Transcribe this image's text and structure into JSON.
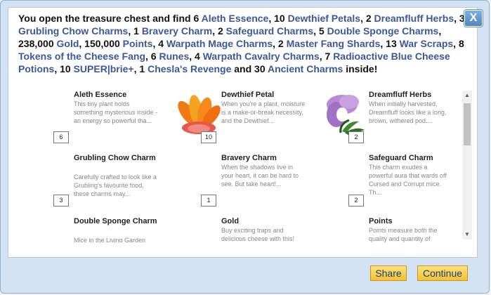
{
  "dialog": {
    "message": {
      "parts": [
        {
          "t": "You open the treasure chest and find 6 ",
          "link": false
        },
        {
          "t": "Aleth Essence",
          "link": true
        },
        {
          "t": ", 10 ",
          "link": false
        },
        {
          "t": "Dewthief Petals",
          "link": true
        },
        {
          "t": ", 2 ",
          "link": false
        },
        {
          "t": "Dreamfluff Herbs",
          "link": true
        },
        {
          "t": ", 3 ",
          "link": false
        },
        {
          "t": "Grubling Chow Charms",
          "link": true
        },
        {
          "t": ", 1 ",
          "link": false
        },
        {
          "t": "Bravery Charm",
          "link": true
        },
        {
          "t": ", 2 ",
          "link": false
        },
        {
          "t": "Safeguard Charms",
          "link": true
        },
        {
          "t": ", 5 ",
          "link": false
        },
        {
          "t": "Double Sponge Charms",
          "link": true
        },
        {
          "t": ", 238,000 ",
          "link": false
        },
        {
          "t": "Gold",
          "link": true
        },
        {
          "t": ", 150,000 ",
          "link": false
        },
        {
          "t": "Points",
          "link": true
        },
        {
          "t": ", 4 ",
          "link": false
        },
        {
          "t": "Warpath Mage Charms",
          "link": true
        },
        {
          "t": ", 2 ",
          "link": false
        },
        {
          "t": "Master Fang Shards",
          "link": true
        },
        {
          "t": ", 13 ",
          "link": false
        },
        {
          "t": "War Scraps",
          "link": true
        },
        {
          "t": ", 8 ",
          "link": false
        },
        {
          "t": "Tokens of the Cheese Fang",
          "link": true
        },
        {
          "t": ", 6 ",
          "link": false
        },
        {
          "t": "Runes",
          "link": true
        },
        {
          "t": ", 4 ",
          "link": false
        },
        {
          "t": "Warpath Cavalry Charms",
          "link": true
        },
        {
          "t": ", 7 ",
          "link": false
        },
        {
          "t": "Radioactive Blue Cheese Potions",
          "link": true
        },
        {
          "t": ", 10 ",
          "link": false
        },
        {
          "t": "SUPER|brie+",
          "link": true
        },
        {
          "t": ", 1 ",
          "link": false
        },
        {
          "t": "Chesla's Revenge",
          "link": true
        },
        {
          "t": " and 30 ",
          "link": false
        },
        {
          "t": "Ancient Charms",
          "link": true
        },
        {
          "t": " inside!",
          "link": false
        }
      ]
    },
    "items": [
      {
        "name": "Aleth Essence",
        "desc": "This tiny plant holds something mysterious inside - an energy so powerful tha...",
        "qty": "6",
        "icon": "none"
      },
      {
        "name": "Dewthief Petal",
        "desc": "When you're a plant, moisture is a make-or-break necessity, and the Dewthief...",
        "qty": "10",
        "icon": "petal"
      },
      {
        "name": "Dreamfluff Herbs",
        "desc": "When initially harvested, Dreamfluff looks like a long, brown, withered pod....",
        "qty": "2",
        "icon": "herb"
      },
      {
        "name": "Grubling Chow Charm",
        "desc": "Carefully crafted to look like a Grubling's favourite food, these charms may...",
        "qty": "3",
        "icon": "none"
      },
      {
        "name": "Bravery Charm",
        "desc": "When the shadows live in your heart, it can be hard to see. But take heart!...",
        "qty": "1",
        "icon": "none"
      },
      {
        "name": "Safeguard Charm",
        "desc": "This charm exudes a powerful aura that wards off Cursed and Corrupt mice. Th...",
        "qty": "2",
        "icon": "none"
      },
      {
        "name": "Double Sponge Charm",
        "desc": "Mice in the Living Garden",
        "qty": "",
        "icon": "none"
      },
      {
        "name": "Gold",
        "desc": "Buy exciting traps and delicious cheese with this!",
        "qty": "",
        "icon": "none"
      },
      {
        "name": "Points",
        "desc": "Points measure both the quality and quantity of",
        "qty": "",
        "icon": "none"
      }
    ],
    "buttons": {
      "share": "Share",
      "continue": "Continue"
    },
    "close_label": "X",
    "colors": {
      "link": "#3b5998",
      "button": "#f4c130",
      "panel_bg": "#d3e3f3"
    }
  }
}
